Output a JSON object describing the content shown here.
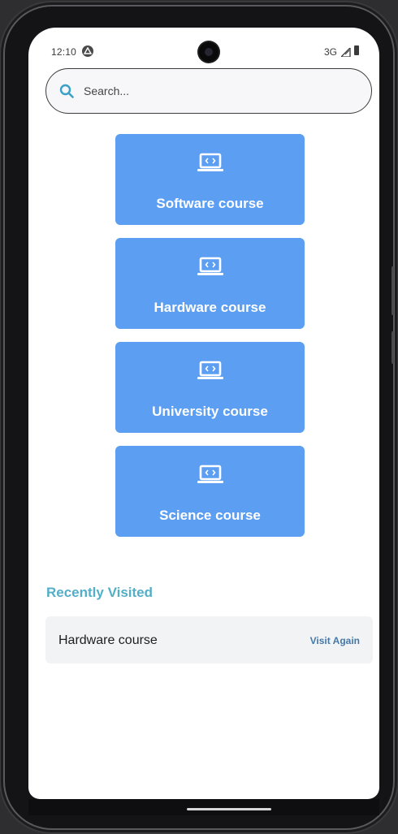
{
  "status_bar": {
    "time": "12:10",
    "network": "3G",
    "icons": [
      "app-notification-icon",
      "signal-icon",
      "battery-icon"
    ]
  },
  "search": {
    "placeholder": "Search...",
    "value": "",
    "icon": "search-icon"
  },
  "courses": [
    {
      "label": "Software course",
      "icon": "laptop-code-icon"
    },
    {
      "label": "Hardware course",
      "icon": "laptop-code-icon"
    },
    {
      "label": "University course",
      "icon": "laptop-code-icon"
    },
    {
      "label": "Science course",
      "icon": "laptop-code-icon"
    }
  ],
  "recently_visited": {
    "title": "Recently Visited",
    "items": [
      {
        "title": "Hardware course",
        "action_label": "Visit Again"
      }
    ]
  },
  "colors": {
    "card_background": "#5b9ef2",
    "section_title": "#53aec8",
    "action_link": "#4578a8",
    "search_icon": "#3aa0c8"
  }
}
